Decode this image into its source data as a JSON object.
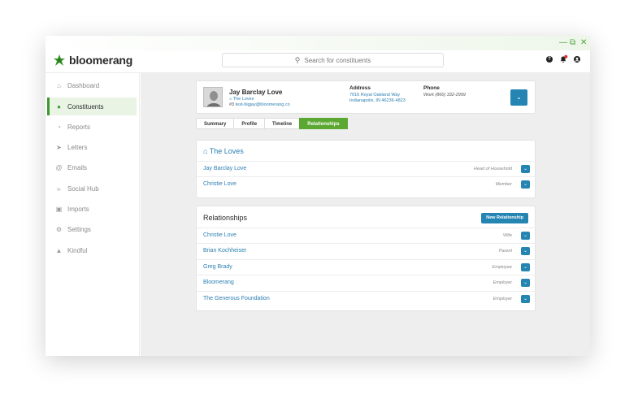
{
  "app": {
    "name": "bloomerang"
  },
  "search": {
    "placeholder": "Search for constituents"
  },
  "sidebar": {
    "items": [
      {
        "label": "Dashboard",
        "icon": "home-icon"
      },
      {
        "label": "Constituents",
        "icon": "users-icon",
        "active": true
      },
      {
        "label": "Reports",
        "icon": "pie-chart-icon"
      },
      {
        "label": "Letters",
        "icon": "send-icon"
      },
      {
        "label": "Emails",
        "icon": "at-icon"
      },
      {
        "label": "Social Hub",
        "icon": "share-icon"
      },
      {
        "label": "Imports",
        "icon": "import-icon"
      },
      {
        "label": "Settings",
        "icon": "gear-icon"
      },
      {
        "label": "Kindful",
        "icon": "kindful-icon"
      }
    ]
  },
  "constituent": {
    "name": "Jay Barclay Love",
    "household": "The Loves",
    "id_prefix": "#3",
    "email": "test-bigjay@bloomerang.co",
    "address_label": "Address",
    "address_line1": "7016 Royal Oakland Way",
    "address_line2": "Indianapolis, IN 46236-4823",
    "phone_label": "Phone",
    "phone": "Work (866) 332-2999"
  },
  "tabs": [
    {
      "label": "Summary"
    },
    {
      "label": "Profile"
    },
    {
      "label": "Timeline"
    },
    {
      "label": "Relationships",
      "active": true
    }
  ],
  "household_card": {
    "title": "The Loves",
    "rows": [
      {
        "name": "Jay Barclay Love",
        "role": "Head of Household"
      },
      {
        "name": "Christie Love",
        "role": "Member"
      }
    ]
  },
  "relationships_card": {
    "title": "Relationships",
    "button": "New Relationship",
    "rows": [
      {
        "name": "Christie Love",
        "role": "Wife"
      },
      {
        "name": "Brian Kochheiser",
        "role": "Parent"
      },
      {
        "name": "Greg Brady",
        "role": "Employee"
      },
      {
        "name": "Bloomerang",
        "role": "Employer"
      },
      {
        "name": "The Generous Foundation",
        "role": "Employer"
      }
    ]
  },
  "colors": {
    "brand_green": "#3b9a2e",
    "accent_blue": "#2485b3",
    "link_blue": "#2d7fb3",
    "tab_green": "#5aa832"
  }
}
